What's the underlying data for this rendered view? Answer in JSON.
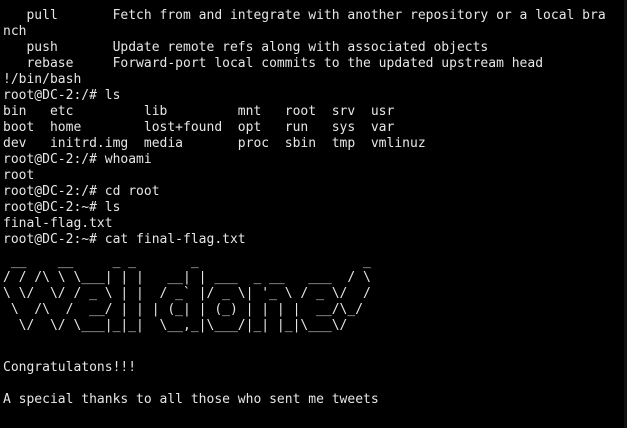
{
  "terminal": {
    "lines": [
      "   pull       Fetch from and integrate with another repository or a local bra",
      "nch",
      "   push       Update remote refs along with associated objects",
      "   rebase     Forward-port local commits to the updated upstream head",
      "!/bin/bash",
      "root@DC-2:/# ls",
      "bin   etc         lib         mnt   root  srv  usr",
      "boot  home        lost+found  opt   run   sys  var",
      "dev   initrd.img  media       proc  sbin  tmp  vmlinuz",
      "root@DC-2:/# whoami",
      "root",
      "root@DC-2:/# cd root",
      "root@DC-2:~# ls",
      "final-flag.txt",
      "root@DC-2:~# cat final-flag.txt"
    ],
    "banner": " __    __     _ _       _                     _ \n/ / /\\ \\ \\___| | |   __| | ___  _ __   ___  / \\\n\\ \\/  \\/ / _ \\ | |  / _` |/ _ \\| '_ \\ / _ \\/  /\n \\  /\\  /  __/ | | | (_| | (_) | | | |  __/\\_/ \n  \\/  \\/ \\___|_|_|  \\__,_|\\___/|_| |_|\\___\\/   ",
    "congrats": "Congratulatons!!!",
    "thanks": "A special thanks to all those who sent me tweets"
  },
  "colors": {
    "background": "#000000",
    "foreground": "#e6e6e6"
  }
}
